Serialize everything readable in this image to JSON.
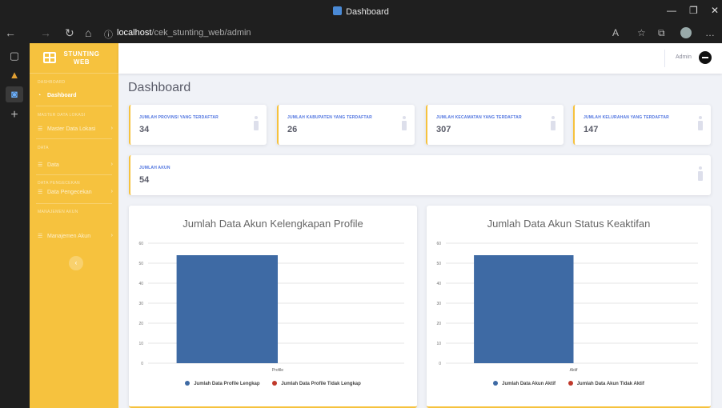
{
  "window": {
    "title": "Dashboard"
  },
  "browser": {
    "url_host": "localhost",
    "url_path": "/cek_stunting_web/admin"
  },
  "sidebar": {
    "brand": "STUNTING WEB",
    "sections": [
      {
        "heading": "DASHBOARD",
        "items": [
          {
            "label": "Dashboard",
            "icon": "dashboard-icon",
            "active": true
          }
        ]
      },
      {
        "heading": "MASTER DATA LOKASI",
        "items": [
          {
            "label": "Master Data Lokasi",
            "icon": "list-icon",
            "active": false
          }
        ]
      },
      {
        "heading": "DATA",
        "items": [
          {
            "label": "Data",
            "icon": "list-icon",
            "active": false
          }
        ]
      },
      {
        "heading": "DATA PENGECEKAN",
        "items": [
          {
            "label": "Data Pengecekan",
            "icon": "list-icon",
            "active": false
          }
        ]
      },
      {
        "heading": "MANAJEMEN AKUN",
        "items": [
          {
            "label": "Manajemen Akun",
            "icon": "list-icon",
            "active": false
          }
        ]
      }
    ],
    "toggle_glyph": "‹"
  },
  "topbar": {
    "user_name": "Admin"
  },
  "page": {
    "title": "Dashboard"
  },
  "stats": [
    {
      "label": "JUMLAH PROVINSI YANG TERDAFTAR",
      "value": "34"
    },
    {
      "label": "JUMLAH KABUPATEN YANG TERDAFTAR",
      "value": "26"
    },
    {
      "label": "JUMLAH KECAMATAN YANG TERDAFTAR",
      "value": "307"
    },
    {
      "label": "JUMLAH KELURAHAN YANG TERDAFTAR",
      "value": "147"
    },
    {
      "label": "JUMLAH AKUN",
      "value": "54"
    }
  ],
  "colors": {
    "accent": "#f6c23e",
    "primary": "#4e73df",
    "series_blue": "#3e6aa4",
    "series_red": "#c0392b"
  },
  "chart_data": [
    {
      "type": "bar",
      "title": "Jumlah Data Akun Kelengkapan Profile",
      "categories": [
        "Profile"
      ],
      "series": [
        {
          "name": "Jumlah Data Profile Lengkap",
          "values": [
            54
          ],
          "color": "#3e6aa4"
        },
        {
          "name": "Jumlah Data Profile Tidak Lengkap",
          "values": [
            0
          ],
          "color": "#c0392b"
        }
      ],
      "ylim": [
        0,
        60
      ],
      "yticks": [
        0,
        10,
        20,
        30,
        40,
        50,
        60
      ],
      "grid": true,
      "legend": "bottom"
    },
    {
      "type": "bar",
      "title": "Jumlah Data Akun Status Keaktifan",
      "categories": [
        "Aktif"
      ],
      "series": [
        {
          "name": "Jumlah Data Akun Aktif",
          "values": [
            54
          ],
          "color": "#3e6aa4"
        },
        {
          "name": "Jumlah Data Akun Tidak Aktif",
          "values": [
            0
          ],
          "color": "#c0392b"
        }
      ],
      "ylim": [
        0,
        60
      ],
      "yticks": [
        0,
        10,
        20,
        30,
        40,
        50,
        60
      ],
      "grid": true,
      "legend": "bottom"
    }
  ]
}
